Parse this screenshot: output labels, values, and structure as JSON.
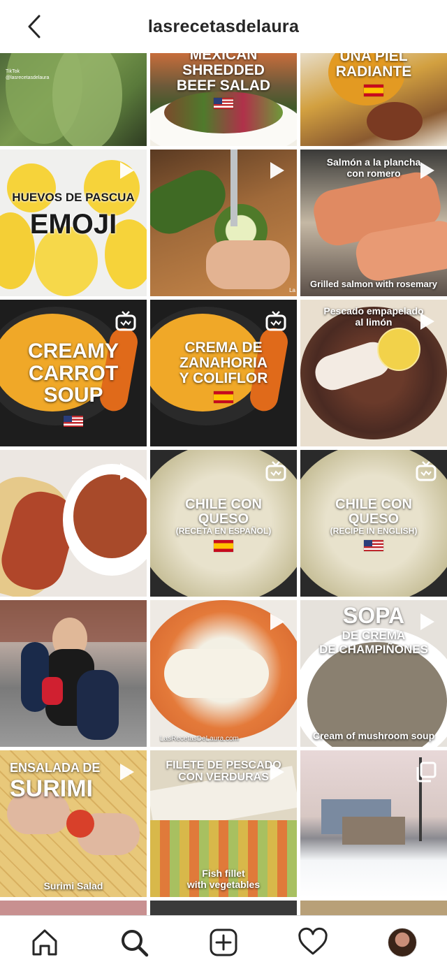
{
  "header": {
    "title": "lasrecetasdelaura",
    "back_icon": "chevron-left-icon"
  },
  "colors": {
    "text": "#262626",
    "divider": "#dbdbdb",
    "background": "#ffffff"
  },
  "posts": [
    {
      "name": "post-nopal",
      "lines": [],
      "caption": [],
      "flag": "",
      "icon": "",
      "watermark": "TikTok\n@lasrecetasdelaura"
    },
    {
      "name": "post-mexican-shredded-beef-salad",
      "lines": [
        "MEXICAN",
        "SHREDDED",
        "BEEF SALAD"
      ],
      "caption": [],
      "flag": "us",
      "icon": ""
    },
    {
      "name": "post-una-piel-radiante",
      "lines": [
        "UNA PIEL",
        "RADIANTE"
      ],
      "caption": [],
      "flag": "es",
      "icon": ""
    },
    {
      "name": "post-huevos-de-pascua-emoji",
      "lines": [
        "HUEVOS DE PASCUA",
        "EMOJI"
      ],
      "caption": [],
      "flag": "",
      "icon": "play-icon"
    },
    {
      "name": "post-zucchini",
      "lines": [],
      "caption": [],
      "flag": "",
      "icon": "play-icon",
      "watermark": "La"
    },
    {
      "name": "post-salmon-a-la-plancha",
      "lines": [
        "Salmón a la plancha",
        "con romero"
      ],
      "caption": [
        "Grilled salmon with rosemary"
      ],
      "flag": "",
      "icon": "play-icon"
    },
    {
      "name": "post-creamy-carrot-soup",
      "lines": [
        "CREAMY",
        "CARROT",
        "SOUP"
      ],
      "caption": [],
      "flag": "us",
      "icon": "igtv-icon"
    },
    {
      "name": "post-crema-de-zanahoria",
      "lines": [
        "CREMA DE",
        "ZANAHORIA",
        "Y COLIFLOR"
      ],
      "caption": [],
      "flag": "es",
      "icon": "igtv-icon"
    },
    {
      "name": "post-pescado-empapelado",
      "lines": [
        "Pescado empapelado",
        "al limón"
      ],
      "caption": [],
      "flag": "",
      "icon": "play-icon"
    },
    {
      "name": "post-tacos",
      "lines": [],
      "caption": [],
      "flag": "",
      "icon": "play-icon"
    },
    {
      "name": "post-chile-con-queso-es",
      "lines": [
        "CHILE CON",
        "QUESO",
        "(RECETA EN ESPAÑOL)"
      ],
      "caption": [],
      "flag": "es",
      "icon": "igtv-icon"
    },
    {
      "name": "post-chile-con-queso-en",
      "lines": [
        "CHILE CON",
        "QUESO",
        "(RECIPE IN ENGLISH)"
      ],
      "caption": [],
      "flag": "us",
      "icon": "igtv-icon"
    },
    {
      "name": "post-family-photo",
      "lines": [],
      "caption": [],
      "flag": "",
      "icon": ""
    },
    {
      "name": "post-fish-rice",
      "lines": [],
      "caption": [],
      "flag": "",
      "icon": "play-icon",
      "watermark": "LasRecetasDeLaura.com"
    },
    {
      "name": "post-sopa-crema-champinones",
      "lines": [
        "SOPA",
        "DE CREMA",
        "DE CHAMPIÑONES"
      ],
      "caption": [
        "Cream of mushroom soup"
      ],
      "flag": "",
      "icon": "play-icon"
    },
    {
      "name": "post-ensalada-de-surimi",
      "lines": [
        "ENSALADA DE",
        "SURIMI"
      ],
      "caption": [
        "Surimi Salad"
      ],
      "flag": "",
      "icon": "play-icon"
    },
    {
      "name": "post-filete-de-pescado",
      "lines": [
        "FILETE DE PESCADO",
        "CON VERDURAS"
      ],
      "caption": [
        "Fish fillet",
        "with vegetables"
      ],
      "flag": "",
      "icon": "play-icon"
    },
    {
      "name": "post-winter-house",
      "lines": [],
      "caption": [],
      "flag": "",
      "icon": "carousel-icon"
    },
    {
      "name": "post-partial-1",
      "lines": [],
      "caption": [],
      "flag": "",
      "icon": ""
    },
    {
      "name": "post-partial-2",
      "lines": [],
      "caption": [],
      "flag": "",
      "icon": ""
    },
    {
      "name": "post-partial-3",
      "lines": [],
      "caption": [],
      "flag": "",
      "icon": ""
    }
  ],
  "tabbar": {
    "items": [
      {
        "name": "tab-home",
        "icon": "home-icon"
      },
      {
        "name": "tab-search",
        "icon": "search-icon"
      },
      {
        "name": "tab-new-post",
        "icon": "add-post-icon"
      },
      {
        "name": "tab-activity",
        "icon": "heart-icon"
      },
      {
        "name": "tab-profile",
        "icon": "avatar"
      }
    ]
  }
}
